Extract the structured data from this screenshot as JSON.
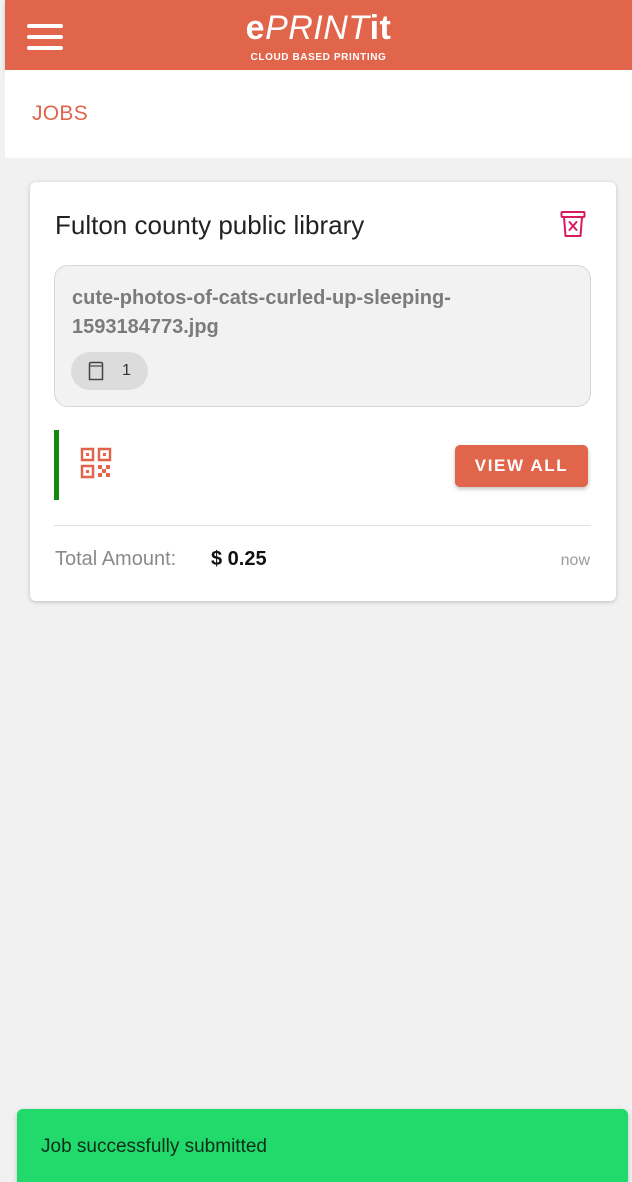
{
  "header": {
    "logo_e": "e",
    "logo_print": "PRINT",
    "logo_it": "it",
    "logo_tagline": "CLOUD BASED PRINTING",
    "menu_icon": "hamburger-menu-icon"
  },
  "page": {
    "title": "JOBS"
  },
  "job_card": {
    "location": "Fulton county public library",
    "delete_icon": "delete-bin-icon",
    "file_name": "cute-photos-of-cats-curled-up-sleeping-1593184773.jpg",
    "copies_icon": "paper-icon",
    "copies": "1",
    "qr_icon": "qr-code-icon",
    "view_all_label": "VIEW ALL",
    "total_label": "Total Amount:",
    "total_value": "$ 0.25",
    "timestamp": "now",
    "status_color": "#138a0b"
  },
  "snackbar": {
    "message": "Job successfully submitted"
  },
  "colors": {
    "brand": "#e0654a",
    "success": "#22d96c",
    "delete_icon": "#d81b60"
  }
}
